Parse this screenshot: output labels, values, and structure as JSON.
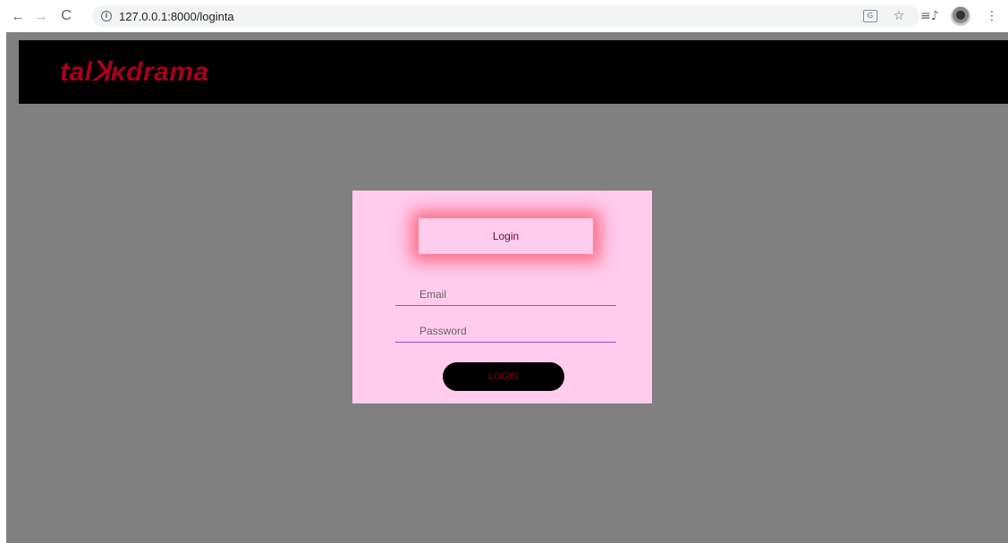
{
  "browser": {
    "url": "127.0.0.1:8000/loginta",
    "back_icon": "←",
    "forward_icon": "→",
    "reload_icon": "C",
    "info_icon": "i",
    "star_icon": "☆",
    "reading_list_icon": "≡♪",
    "menu_icon": "⋮"
  },
  "site": {
    "logo_text": "talꓘκdrama",
    "logo_color": "#a5001c",
    "header_bg": "#000000",
    "page_bg": "#808080"
  },
  "login": {
    "heading": "Login",
    "email_placeholder": "Email",
    "password_placeholder": "Password",
    "submit_label": "LOGIN",
    "card_bg": "#ffccee",
    "glow_color": "#ff465a",
    "field_underline_color": "#9b4fc4"
  }
}
